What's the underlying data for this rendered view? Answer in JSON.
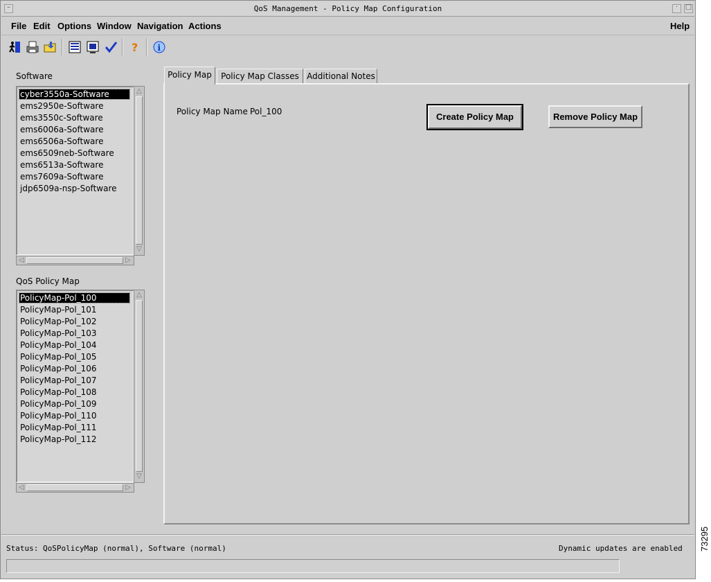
{
  "window": {
    "title": "QoS Management - Policy Map Configuration"
  },
  "menubar": {
    "items": [
      "File",
      "Edit",
      "Options",
      "Window",
      "Navigation",
      "Actions"
    ],
    "help": "Help"
  },
  "toolbar": {
    "icons": [
      "exit-icon",
      "print-icon",
      "open-folder-icon",
      "list-icon",
      "monitor-icon",
      "checkmark-icon",
      "help-icon",
      "info-icon"
    ]
  },
  "software": {
    "label": "Software",
    "items": [
      "cyber3550a-Software",
      "ems2950e-Software",
      "ems3550c-Software",
      "ems6006a-Software",
      "ems6506a-Software",
      "ems6509neb-Software",
      "ems6513a-Software",
      "ems7609a-Software",
      "jdp6509a-nsp-Software"
    ],
    "selected_index": 0
  },
  "policy_maps": {
    "label": "QoS Policy Map",
    "items": [
      "PolicyMap-Pol_100",
      "PolicyMap-Pol_101",
      "PolicyMap-Pol_102",
      "PolicyMap-Pol_103",
      "PolicyMap-Pol_104",
      "PolicyMap-Pol_105",
      "PolicyMap-Pol_106",
      "PolicyMap-Pol_107",
      "PolicyMap-Pol_108",
      "PolicyMap-Pol_109",
      "PolicyMap-Pol_110",
      "PolicyMap-Pol_111",
      "PolicyMap-Pol_112"
    ],
    "selected_index": 0
  },
  "tabs": [
    {
      "label": "Policy Map",
      "active": true
    },
    {
      "label": "Policy Map Classes",
      "active": false
    },
    {
      "label": "Additional Notes",
      "active": false
    }
  ],
  "policy_map_tab": {
    "name_label": "Policy Map Name",
    "name_value": "Pol_100",
    "create_button": "Create Policy Map",
    "remove_button": "Remove Policy Map"
  },
  "status": {
    "text": "Status: QoSPolicyMap (normal), Software (normal)",
    "updates": "Dynamic updates are enabled"
  },
  "figure_number": "73295"
}
